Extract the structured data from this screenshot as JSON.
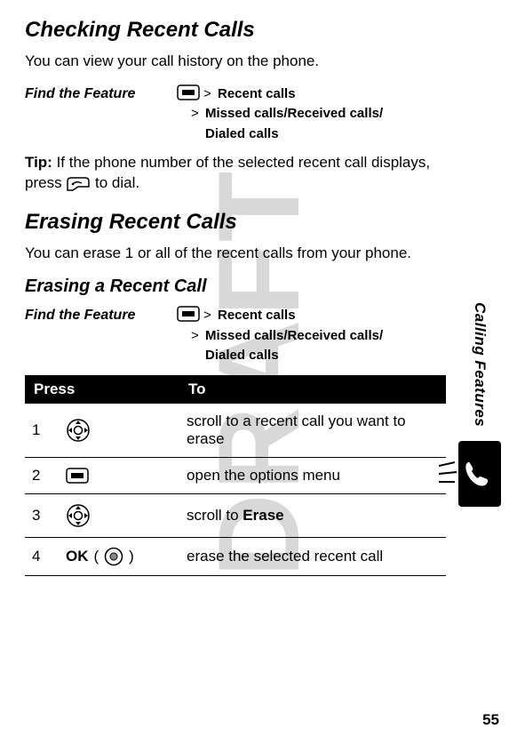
{
  "watermark": "DRAFT",
  "section1": {
    "heading": "Checking Recent Calls",
    "intro": "You can view your call history on the phone.",
    "feature_label": "Find the Feature",
    "path_line1": "Recent calls",
    "path_line2": "Missed calls/Received calls/",
    "path_line3": "Dialed calls",
    "tip_label": "Tip:",
    "tip_text_before": " If the phone number of the selected recent call displays, press ",
    "tip_text_after": " to dial."
  },
  "section2": {
    "heading": "Erasing Recent Calls",
    "intro": "You can erase 1 or all of the recent calls from your phone.",
    "subhead": "Erasing a Recent Call",
    "feature_label": "Find the Feature",
    "path_line1": "Recent calls",
    "path_line2": "Missed calls/Received calls/",
    "path_line3": "Dialed calls"
  },
  "table": {
    "col_press": "Press",
    "col_to": "To",
    "rows": [
      {
        "n": "1",
        "to": "scroll to a recent call you want to erase"
      },
      {
        "n": "2",
        "to": "open the options menu"
      },
      {
        "n": "3",
        "to_prefix": "scroll to ",
        "to_bold": "Erase"
      },
      {
        "n": "4",
        "press_label": "OK",
        "to": "erase the selected recent call"
      }
    ]
  },
  "sidebar_label": "Calling Features",
  "page_number": "55"
}
